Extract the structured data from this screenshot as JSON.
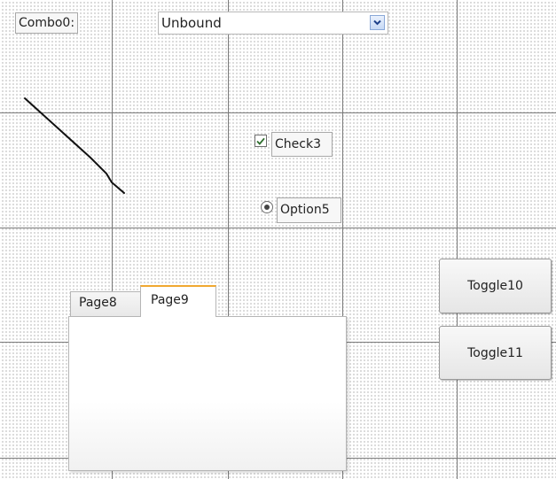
{
  "form": {
    "combo_label": "Combo0:",
    "combo_value": "Unbound",
    "checkbox_label": "Check3",
    "checkbox_checked": true,
    "option_label": "Option5",
    "option_selected": true,
    "toggle_1": "Toggle10",
    "toggle_2": "Toggle11"
  },
  "tab_control": {
    "tabs": [
      {
        "label": "Page8",
        "active": false
      },
      {
        "label": "Page9",
        "active": true
      }
    ]
  },
  "colors": {
    "grid_dots": "#8a8a8a",
    "grid_lines": "#7a7a7a",
    "active_tab_accent": "#f0a830",
    "combo_button": "#c7d9f5"
  },
  "icons": {
    "combo_arrow": "chevron-down-icon",
    "check": "checkmark-icon",
    "radio": "radio-dot-icon"
  }
}
